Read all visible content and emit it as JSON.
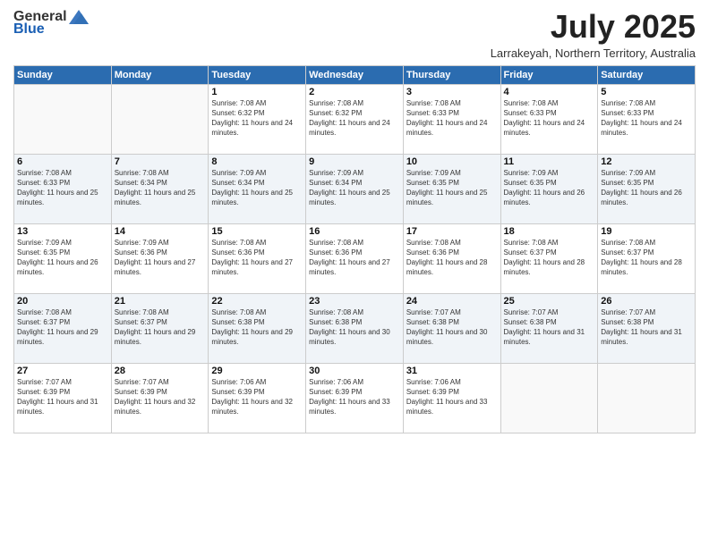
{
  "logo": {
    "general": "General",
    "blue": "Blue"
  },
  "title": {
    "month": "July 2025",
    "location": "Larrakeyah, Northern Territory, Australia"
  },
  "days_of_week": [
    "Sunday",
    "Monday",
    "Tuesday",
    "Wednesday",
    "Thursday",
    "Friday",
    "Saturday"
  ],
  "weeks": [
    [
      {
        "day": "",
        "sunrise": "",
        "sunset": "",
        "daylight": ""
      },
      {
        "day": "",
        "sunrise": "",
        "sunset": "",
        "daylight": ""
      },
      {
        "day": "1",
        "sunrise": "Sunrise: 7:08 AM",
        "sunset": "Sunset: 6:32 PM",
        "daylight": "Daylight: 11 hours and 24 minutes."
      },
      {
        "day": "2",
        "sunrise": "Sunrise: 7:08 AM",
        "sunset": "Sunset: 6:32 PM",
        "daylight": "Daylight: 11 hours and 24 minutes."
      },
      {
        "day": "3",
        "sunrise": "Sunrise: 7:08 AM",
        "sunset": "Sunset: 6:33 PM",
        "daylight": "Daylight: 11 hours and 24 minutes."
      },
      {
        "day": "4",
        "sunrise": "Sunrise: 7:08 AM",
        "sunset": "Sunset: 6:33 PM",
        "daylight": "Daylight: 11 hours and 24 minutes."
      },
      {
        "day": "5",
        "sunrise": "Sunrise: 7:08 AM",
        "sunset": "Sunset: 6:33 PM",
        "daylight": "Daylight: 11 hours and 24 minutes."
      }
    ],
    [
      {
        "day": "6",
        "sunrise": "Sunrise: 7:08 AM",
        "sunset": "Sunset: 6:33 PM",
        "daylight": "Daylight: 11 hours and 25 minutes."
      },
      {
        "day": "7",
        "sunrise": "Sunrise: 7:08 AM",
        "sunset": "Sunset: 6:34 PM",
        "daylight": "Daylight: 11 hours and 25 minutes."
      },
      {
        "day": "8",
        "sunrise": "Sunrise: 7:09 AM",
        "sunset": "Sunset: 6:34 PM",
        "daylight": "Daylight: 11 hours and 25 minutes."
      },
      {
        "day": "9",
        "sunrise": "Sunrise: 7:09 AM",
        "sunset": "Sunset: 6:34 PM",
        "daylight": "Daylight: 11 hours and 25 minutes."
      },
      {
        "day": "10",
        "sunrise": "Sunrise: 7:09 AM",
        "sunset": "Sunset: 6:35 PM",
        "daylight": "Daylight: 11 hours and 25 minutes."
      },
      {
        "day": "11",
        "sunrise": "Sunrise: 7:09 AM",
        "sunset": "Sunset: 6:35 PM",
        "daylight": "Daylight: 11 hours and 26 minutes."
      },
      {
        "day": "12",
        "sunrise": "Sunrise: 7:09 AM",
        "sunset": "Sunset: 6:35 PM",
        "daylight": "Daylight: 11 hours and 26 minutes."
      }
    ],
    [
      {
        "day": "13",
        "sunrise": "Sunrise: 7:09 AM",
        "sunset": "Sunset: 6:35 PM",
        "daylight": "Daylight: 11 hours and 26 minutes."
      },
      {
        "day": "14",
        "sunrise": "Sunrise: 7:09 AM",
        "sunset": "Sunset: 6:36 PM",
        "daylight": "Daylight: 11 hours and 27 minutes."
      },
      {
        "day": "15",
        "sunrise": "Sunrise: 7:08 AM",
        "sunset": "Sunset: 6:36 PM",
        "daylight": "Daylight: 11 hours and 27 minutes."
      },
      {
        "day": "16",
        "sunrise": "Sunrise: 7:08 AM",
        "sunset": "Sunset: 6:36 PM",
        "daylight": "Daylight: 11 hours and 27 minutes."
      },
      {
        "day": "17",
        "sunrise": "Sunrise: 7:08 AM",
        "sunset": "Sunset: 6:36 PM",
        "daylight": "Daylight: 11 hours and 28 minutes."
      },
      {
        "day": "18",
        "sunrise": "Sunrise: 7:08 AM",
        "sunset": "Sunset: 6:37 PM",
        "daylight": "Daylight: 11 hours and 28 minutes."
      },
      {
        "day": "19",
        "sunrise": "Sunrise: 7:08 AM",
        "sunset": "Sunset: 6:37 PM",
        "daylight": "Daylight: 11 hours and 28 minutes."
      }
    ],
    [
      {
        "day": "20",
        "sunrise": "Sunrise: 7:08 AM",
        "sunset": "Sunset: 6:37 PM",
        "daylight": "Daylight: 11 hours and 29 minutes."
      },
      {
        "day": "21",
        "sunrise": "Sunrise: 7:08 AM",
        "sunset": "Sunset: 6:37 PM",
        "daylight": "Daylight: 11 hours and 29 minutes."
      },
      {
        "day": "22",
        "sunrise": "Sunrise: 7:08 AM",
        "sunset": "Sunset: 6:38 PM",
        "daylight": "Daylight: 11 hours and 29 minutes."
      },
      {
        "day": "23",
        "sunrise": "Sunrise: 7:08 AM",
        "sunset": "Sunset: 6:38 PM",
        "daylight": "Daylight: 11 hours and 30 minutes."
      },
      {
        "day": "24",
        "sunrise": "Sunrise: 7:07 AM",
        "sunset": "Sunset: 6:38 PM",
        "daylight": "Daylight: 11 hours and 30 minutes."
      },
      {
        "day": "25",
        "sunrise": "Sunrise: 7:07 AM",
        "sunset": "Sunset: 6:38 PM",
        "daylight": "Daylight: 11 hours and 31 minutes."
      },
      {
        "day": "26",
        "sunrise": "Sunrise: 7:07 AM",
        "sunset": "Sunset: 6:38 PM",
        "daylight": "Daylight: 11 hours and 31 minutes."
      }
    ],
    [
      {
        "day": "27",
        "sunrise": "Sunrise: 7:07 AM",
        "sunset": "Sunset: 6:39 PM",
        "daylight": "Daylight: 11 hours and 31 minutes."
      },
      {
        "day": "28",
        "sunrise": "Sunrise: 7:07 AM",
        "sunset": "Sunset: 6:39 PM",
        "daylight": "Daylight: 11 hours and 32 minutes."
      },
      {
        "day": "29",
        "sunrise": "Sunrise: 7:06 AM",
        "sunset": "Sunset: 6:39 PM",
        "daylight": "Daylight: 11 hours and 32 minutes."
      },
      {
        "day": "30",
        "sunrise": "Sunrise: 7:06 AM",
        "sunset": "Sunset: 6:39 PM",
        "daylight": "Daylight: 11 hours and 33 minutes."
      },
      {
        "day": "31",
        "sunrise": "Sunrise: 7:06 AM",
        "sunset": "Sunset: 6:39 PM",
        "daylight": "Daylight: 11 hours and 33 minutes."
      },
      {
        "day": "",
        "sunrise": "",
        "sunset": "",
        "daylight": ""
      },
      {
        "day": "",
        "sunrise": "",
        "sunset": "",
        "daylight": ""
      }
    ]
  ]
}
